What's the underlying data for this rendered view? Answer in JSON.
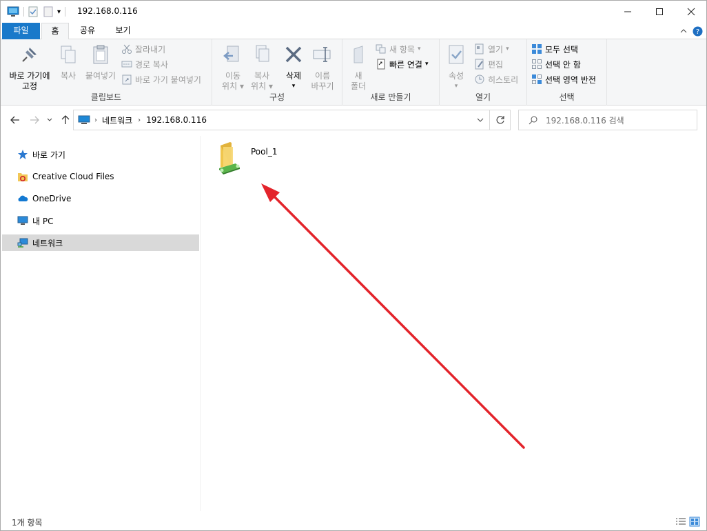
{
  "window": {
    "title": "192.168.0.116"
  },
  "ribbon_tabs": [
    "파일",
    "홈",
    "공유",
    "보기"
  ],
  "ribbon": {
    "clipboard": {
      "label": "클립보드",
      "pin": [
        "바로 가기에",
        "고정"
      ],
      "copy": "복사",
      "paste": "붙여넣기",
      "cut": "잘라내기",
      "copy_path": "경로 복사",
      "paste_shortcut": "바로 가기 붙여넣기"
    },
    "organize": {
      "label": "구성",
      "move_to": [
        "이동",
        "위치"
      ],
      "copy_to": [
        "복사",
        "위치"
      ],
      "delete": "삭제",
      "rename": [
        "이름",
        "바꾸기"
      ]
    },
    "new": {
      "label": "새로 만들기",
      "new_folder": [
        "새",
        "폴더"
      ],
      "new_item": "새 항목",
      "easy_access": "빠른 연결"
    },
    "open": {
      "label": "열기",
      "properties": "속성",
      "open": "열기",
      "edit": "편집",
      "history": "히스토리"
    },
    "select": {
      "label": "선택",
      "select_all": "모두 선택",
      "select_none": "선택 안 함",
      "invert": "선택 영역 반전"
    }
  },
  "address": {
    "crumbs": [
      "네트워크",
      "192.168.0.116"
    ],
    "search_placeholder": "192.168.0.116 검색"
  },
  "nav_pane": [
    {
      "label": "바로 가기",
      "icon": "star-icon"
    },
    {
      "label": "Creative Cloud Files",
      "icon": "creative-cloud-icon"
    },
    {
      "label": "OneDrive",
      "icon": "onedrive-icon"
    },
    {
      "label": "내 PC",
      "icon": "pc-icon"
    },
    {
      "label": "네트워크",
      "icon": "network-icon",
      "selected": true
    }
  ],
  "files": [
    {
      "name": "Pool_1",
      "icon": "shared-folder-icon"
    }
  ],
  "status": {
    "count": "1개 항목"
  },
  "colors": {
    "accent": "#1979ca",
    "arrow": "#e3242b"
  }
}
